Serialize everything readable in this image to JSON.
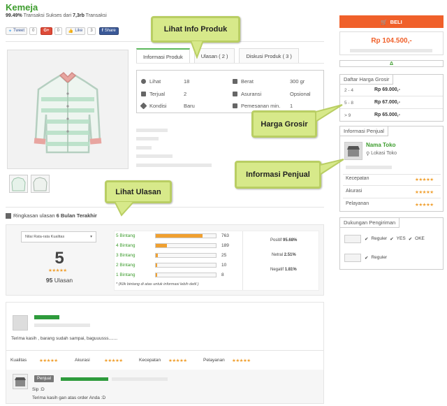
{
  "product": {
    "title": "Kemeja",
    "stats_pct": "99.49%",
    "stats_mid": " Transaksi Sukses dari ",
    "stats_count": "7,3rb",
    "stats_end": " Transaksi"
  },
  "share": {
    "tweet": "Tweet",
    "tweet_count": "0",
    "gplus": "G+",
    "gplus_count": "0",
    "like": "Like",
    "like_count": "3",
    "fb": "Share"
  },
  "tabs": [
    "Informasi Produk",
    "Ulasan ( 2 )",
    "Diskusi Produk ( 3 )"
  ],
  "info": {
    "lihat_label": "Lihat",
    "lihat_value": "18",
    "terjual_label": "Terjual",
    "terjual_value": "2",
    "kondisi_label": "Kondisi",
    "kondisi_value": "Baru",
    "berat_label": "Berat",
    "berat_value": "300 gr",
    "asuransi_label": "Asuransi",
    "asuransi_value": "Opsional",
    "pemesanan_label": "Pemesanan min.",
    "pemesanan_value": "1"
  },
  "callouts": {
    "info_produk": "Lihat Info Produk",
    "harga_grosir": "Harga Grosir",
    "info_penjual": "Informasi Penjual",
    "lihat_ulasan": "Lihat Ulasan"
  },
  "buy": {
    "button": "BELI",
    "price": "Rp 104.500,-",
    "indicator": "Δ"
  },
  "grosir": {
    "title": "Daftar Harga Grosir",
    "rows": [
      {
        "range": "2 - 4",
        "price": "Rp 69.000,-"
      },
      {
        "range": "5 - 8",
        "price": "Rp 67.000,-"
      },
      {
        "range": "> 9",
        "price": "Rp 65.000,-"
      }
    ]
  },
  "seller": {
    "title": "Informasi Penjual",
    "name": "Nama Toko",
    "location": "Lokasi Toko",
    "ratings": [
      "Kecepatan",
      "Akurasi",
      "Pelayanan"
    ]
  },
  "shipping": {
    "title": "Dukungan Pengiriman",
    "row1": [
      "Reguler",
      "YES",
      "OKE"
    ],
    "row2": [
      "Reguler"
    ]
  },
  "review_summary": {
    "prefix": "Ringkasan ulasan ",
    "period": "6 Bulan Terakhir",
    "dropdown": "Nilai Rata-rata Kualitas",
    "score": "5",
    "count": "95",
    "count_label": "Ulasan",
    "note": "* (Klik bintang di atas untuk informasi lebih detil )",
    "bars": [
      {
        "label": "5 Bintang",
        "count": "763",
        "fill": 0.78
      },
      {
        "label": "4 Bintang",
        "count": "189",
        "fill": 0.19
      },
      {
        "label": "3 Bintang",
        "count": "25",
        "fill": 0.03
      },
      {
        "label": "2 Bintang",
        "count": "10",
        "fill": 0.01
      },
      {
        "label": "1 Bintang",
        "count": "8",
        "fill": 0.01
      }
    ],
    "positif_label": "Positif",
    "positif": "95.68%",
    "netral_label": "Netral",
    "netral": "2.51%",
    "negatif_label": "Negatif",
    "negatif": "1.81%"
  },
  "review": {
    "text": "Terima kasih , barang sudah sampai, baguuusss.......",
    "criteria": [
      "Kualitas",
      "Akurasi",
      "Kecepatan",
      "Pelayanan"
    ],
    "reply_badge": "Penjual",
    "reply_line1": "Sip :D",
    "reply_line2": "Terima kasih gan atas order Anda :D"
  },
  "stars": "★★★★★",
  "colors": {
    "green": "#3c9c2c",
    "orange": "#f0602a",
    "star": "#f0a030",
    "callout": "#d7e98a"
  }
}
